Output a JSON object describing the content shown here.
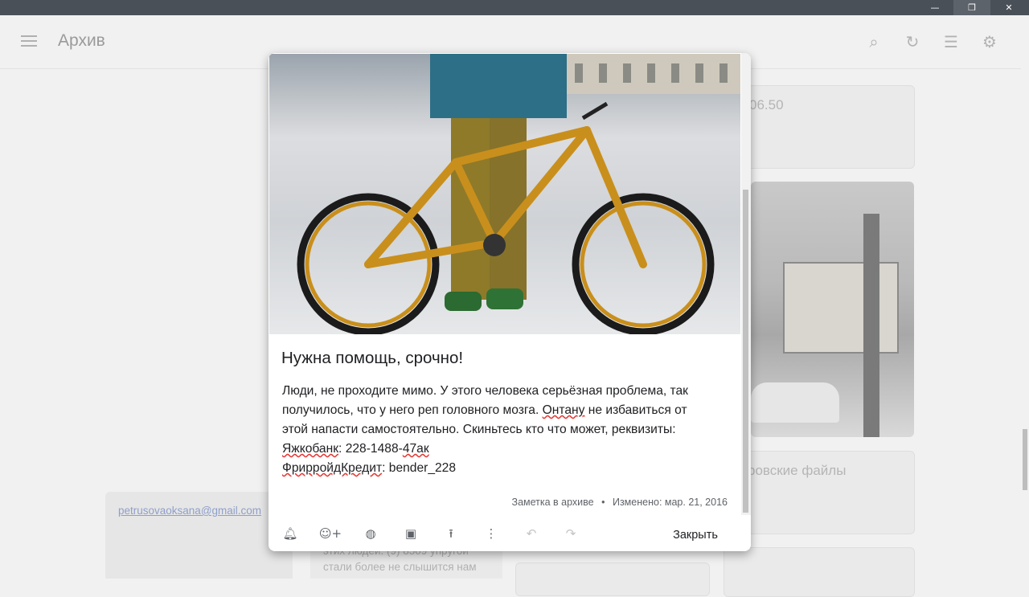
{
  "window": {
    "minimize_icon": "minimize-icon",
    "maximize_icon": "restore-icon",
    "close_icon": "close-icon"
  },
  "header": {
    "title": "Архив",
    "icons": [
      "menu-icon",
      "search-icon",
      "refresh-icon",
      "list-view-icon",
      "settings-icon"
    ]
  },
  "background": {
    "card1_text": "06.50",
    "card3_text": "ровские файлы",
    "email": "petrusovaoksana@gmail.com",
    "bottom_note_line1": "этих людей. (9) 8509 упругой",
    "bottom_note_line2": "стали более не слышится нам"
  },
  "note": {
    "title": "Нужна помощь, срочно!",
    "body": {
      "l1": "Люди, не проходите мимо. У этого человека серьёзная проблема, так",
      "l2_a": "получилось, что у него реп головного мозга. ",
      "l2_b": "Онтану",
      "l2_c": " не избавиться от",
      "l3": "этой напасти самостоятельно. Скиньтесь кто что может, реквизиты:",
      "l4_a": "Яжкобанк",
      "l4_b": ": 228-1488-",
      "l4_c": "47ак",
      "l5_a": "ФрирройдКредит",
      "l5_b": ": bender_228"
    },
    "status": "Заметка в архиве",
    "separator": "•",
    "modified": "Изменено: мар. 21, 2016"
  },
  "toolbar": {
    "close_label": "Закрыть",
    "icons": [
      "reminder-icon",
      "collaborator-icon",
      "palette-icon",
      "image-icon",
      "unarchive-icon",
      "more-icon",
      "undo-icon",
      "redo-icon"
    ]
  },
  "colors": {
    "titlebar": "#4a5058",
    "modal_bg": "#ffffff",
    "spellcheck": "#e53935",
    "bike": "#c98f1c"
  }
}
